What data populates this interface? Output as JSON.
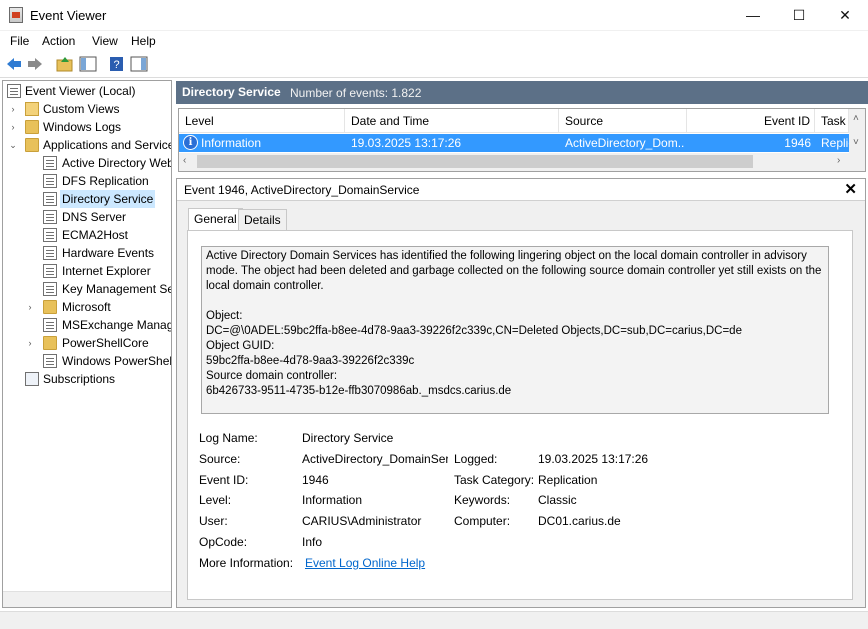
{
  "window": {
    "title": "Event Viewer",
    "minimize": "—",
    "maximize": "☐",
    "close": "✕"
  },
  "menu": [
    "File",
    "Action",
    "View",
    "Help"
  ],
  "tree": {
    "root": "Event Viewer (Local)",
    "items": [
      {
        "label": "Custom Views"
      },
      {
        "label": "Windows Logs"
      },
      {
        "label": "Applications and Services"
      },
      {
        "label": "Active Directory Web"
      },
      {
        "label": "DFS Replication"
      },
      {
        "label": "Directory Service"
      },
      {
        "label": "DNS Server"
      },
      {
        "label": "ECMA2Host"
      },
      {
        "label": "Hardware Events"
      },
      {
        "label": "Internet Explorer"
      },
      {
        "label": "Key Management Ser"
      },
      {
        "label": "Microsoft"
      },
      {
        "label": "MSExchange Manage"
      },
      {
        "label": "PowerShellCore"
      },
      {
        "label": "Windows PowerShell"
      },
      {
        "label": "Subscriptions"
      }
    ]
  },
  "header": {
    "title": "Directory Service",
    "count": "Number of events: 1.822"
  },
  "list": {
    "columns": [
      "Level",
      "Date and Time",
      "Source",
      "Event ID",
      "Task C"
    ],
    "row": {
      "level": "Information",
      "date": "19.03.2025 13:17:26",
      "source": "ActiveDirectory_Dom...",
      "event_id": "1946",
      "task": "Replic"
    }
  },
  "detail": {
    "title": "Event 1946, ActiveDirectory_DomainService",
    "tabs": [
      "General",
      "Details"
    ],
    "description": [
      "Active Directory Domain Services has identified the following lingering object on the local domain controller in advisory",
      "mode. The object had been deleted and garbage collected on the following source domain controller yet still exists on the",
      "local domain controller.",
      "",
      "Object:",
      "DC=@\\0ADEL:59bc2ffa-b8ee-4d78-9aa3-39226f2c339c,CN=Deleted Objects,DC=sub,DC=carius,DC=de",
      "Object GUID:",
      "59bc2ffa-b8ee-4d78-9aa3-39226f2c339c",
      "Source domain controller:",
      "6b426733-9511-4735-b12e-ffb3070986ab._msdcs.carius.de"
    ],
    "props": {
      "log_name_label": "Log Name:",
      "log_name": "Directory Service",
      "source_label": "Source:",
      "source": "ActiveDirectory_DomainServ",
      "logged_label": "Logged:",
      "logged": "19.03.2025 13:17:26",
      "event_id_label": "Event ID:",
      "event_id": "1946",
      "task_label": "Task Category:",
      "task": "Replication",
      "level_label": "Level:",
      "level": "Information",
      "keywords_label": "Keywords:",
      "keywords": "Classic",
      "user_label": "User:",
      "user": "CARIUS\\Administrator",
      "computer_label": "Computer:",
      "computer": "DC01.carius.de",
      "opcode_label": "OpCode:",
      "opcode": "Info",
      "more_label": "More Information:",
      "more_link": "Event Log Online Help"
    }
  }
}
